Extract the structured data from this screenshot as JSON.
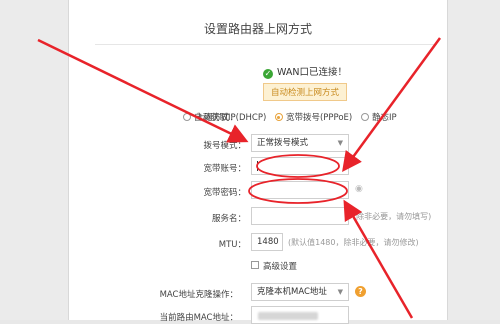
{
  "page": {
    "title": "设置路由器上网方式"
  },
  "status": {
    "text": "WAN口已连接！"
  },
  "detect_button": {
    "label": "自动检测上网方式"
  },
  "form": {
    "conn_type": {
      "label": "上网方式：",
      "options": [
        "自动获取IP(DHCP)",
        "宽带拨号(PPPoE)",
        "静态IP"
      ],
      "selected": "宽带拨号(PPPoE)"
    },
    "dial_mode": {
      "label": "拨号模式：",
      "value": "正常拨号模式"
    },
    "account": {
      "label": "宽带账号：",
      "value": ""
    },
    "password": {
      "label": "宽带密码：",
      "value": ""
    },
    "service": {
      "label": "服务名：",
      "value": "",
      "hint": "(除非必要，请勿填写)"
    },
    "mtu": {
      "label": "MTU：",
      "value": "1480",
      "hint": "(默认值1480，除非必要，请勿修改)"
    },
    "advanced": {
      "label": "高级设置"
    },
    "mac_clone": {
      "label": "MAC地址克隆操作：",
      "value": "克隆本机MAC地址"
    },
    "current_mac": {
      "label": "当前路由MAC地址："
    }
  },
  "colors": {
    "arrow": "#e8232a",
    "accent": "#e8a33b",
    "ok": "#3aa635"
  }
}
